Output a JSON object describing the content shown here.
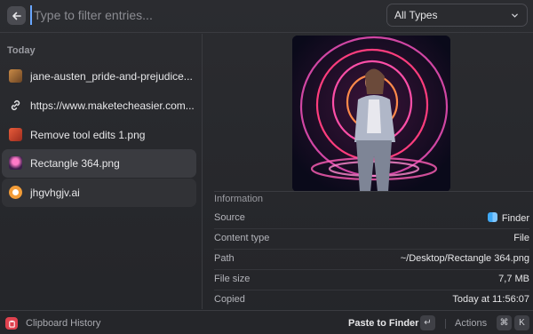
{
  "search": {
    "placeholder": "Type to filter entries..."
  },
  "filter": {
    "selected": "All Types"
  },
  "list": {
    "section": "Today",
    "items": [
      {
        "label": "jane-austen_pride-and-prejudice...",
        "icon": "image-thumbnail-icon"
      },
      {
        "label": "https://www.maketecheasier.com...",
        "icon": "link-icon"
      },
      {
        "label": "Remove tool edits 1.png",
        "icon": "image-thumbnail-icon"
      },
      {
        "label": "Rectangle 364.png",
        "icon": "image-thumbnail-icon"
      },
      {
        "label": "jhgvhgjv.ai",
        "icon": "illustrator-file-icon"
      }
    ],
    "selected_index": 3
  },
  "detail": {
    "info_title": "Information",
    "rows": [
      {
        "key": "Source",
        "value": "Finder"
      },
      {
        "key": "Content type",
        "value": "File"
      },
      {
        "key": "Path",
        "value": "~/Desktop/Rectangle 364.png"
      },
      {
        "key": "File size",
        "value": "7,7 MB"
      },
      {
        "key": "Copied",
        "value": "Today at 11:56:07"
      }
    ]
  },
  "bottombar": {
    "app_name": "Clipboard History",
    "primary_action": "Paste to Finder",
    "primary_key": "↵",
    "actions_label": "Actions",
    "actions_keys": [
      "⌘",
      "K"
    ]
  },
  "colors": {
    "accent": "#6aa7ff",
    "app_icon": "#e0424f",
    "selection": "#3a3b40"
  }
}
